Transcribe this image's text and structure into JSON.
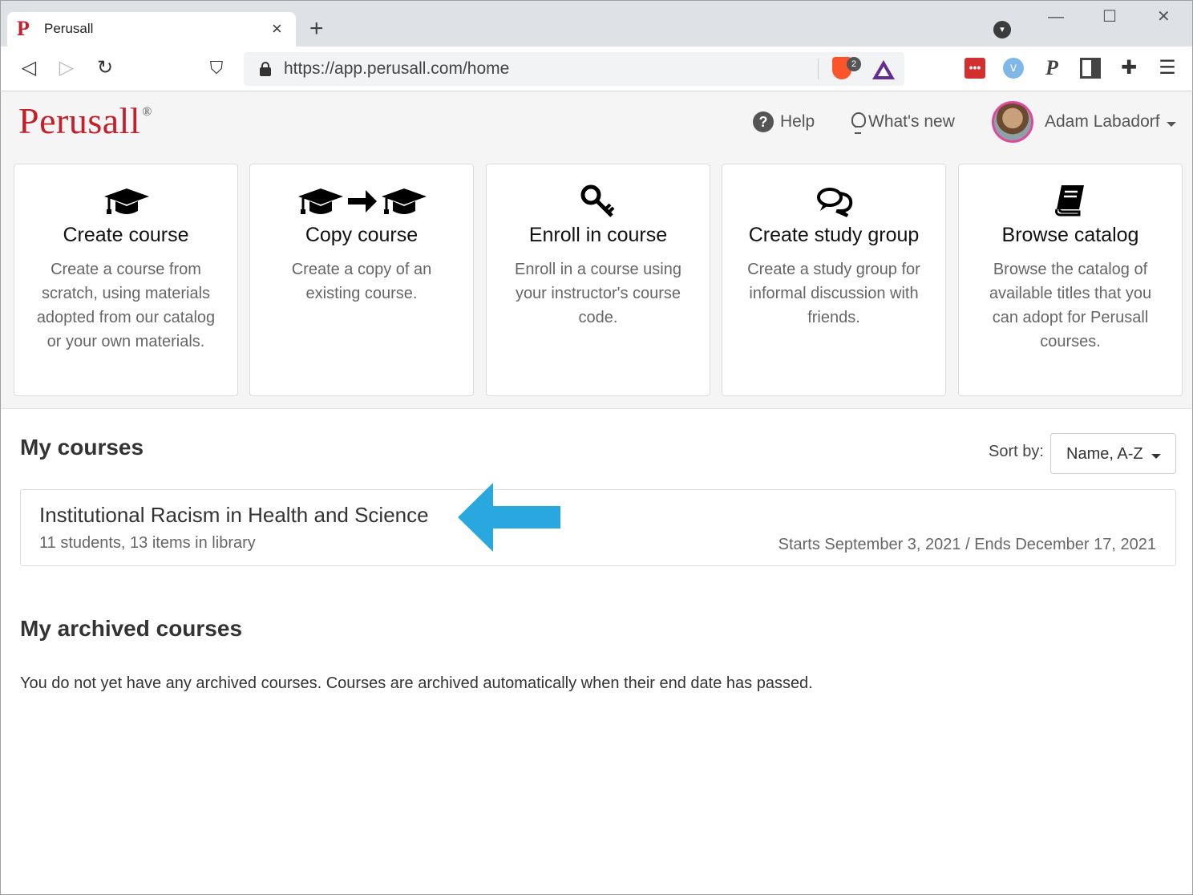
{
  "browser": {
    "tab_title": "Perusall",
    "tab_favicon": "P",
    "tab_close": "×",
    "new_tab": "+",
    "profile_badge": "▾",
    "url": "https://app.perusall.com/home",
    "brave_badge_count": "2",
    "window_controls": {
      "minimize": "—",
      "maximize": "☐",
      "close": "✕"
    },
    "nav": {
      "back": "◁",
      "forward": "▷",
      "reload": "↻",
      "bookmark": "⛉"
    },
    "extensions": [
      "lastpass-icon",
      "vimeo-icon",
      "perusall-icon",
      "sidebar-icon",
      "puzzle-icon",
      "menu-icon"
    ],
    "ext_glyphs": {
      "lastpass": "•••",
      "vimeo": "v",
      "perusall": "P",
      "puzzle": "✚",
      "menu": "☰"
    }
  },
  "header": {
    "logo_text": "Perusall",
    "logo_mark": "®",
    "help_icon": "?",
    "help_label": "Help",
    "whats_new_label": "What's new",
    "user_name": "Adam Labadorf"
  },
  "cards": [
    {
      "title": "Create course",
      "description": "Create a course from scratch, using materials adopted from our catalog or your own materials.",
      "icon": "graduation-cap-icon"
    },
    {
      "title": "Copy course",
      "description": "Create a copy of an existing course.",
      "icon": "copy-course-icon"
    },
    {
      "title": "Enroll in course",
      "description": "Enroll in a course using your instructor's course code.",
      "icon": "key-icon"
    },
    {
      "title": "Create study group",
      "description": "Create a study group for informal discussion with friends.",
      "icon": "comments-icon"
    },
    {
      "title": "Browse catalog",
      "description": "Browse the catalog of available titles that you can adopt for Perusall courses.",
      "icon": "book-icon"
    }
  ],
  "my_courses": {
    "heading": "My courses",
    "sort_label": "Sort by:",
    "sort_value": "Name, A-Z",
    "courses": [
      {
        "name": "Institutional Racism in Health and Science",
        "meta": "11 students, 13 items in library",
        "dates": "Starts September 3, 2021 / Ends December 17, 2021"
      }
    ]
  },
  "archived": {
    "heading": "My archived courses",
    "empty_message": "You do not yet have any archived courses. Courses are archived automatically when their end date has passed."
  },
  "colors": {
    "brand": "#c4202b",
    "callout_arrow": "#29a8e0",
    "avatar_ring": "#e0499b"
  }
}
